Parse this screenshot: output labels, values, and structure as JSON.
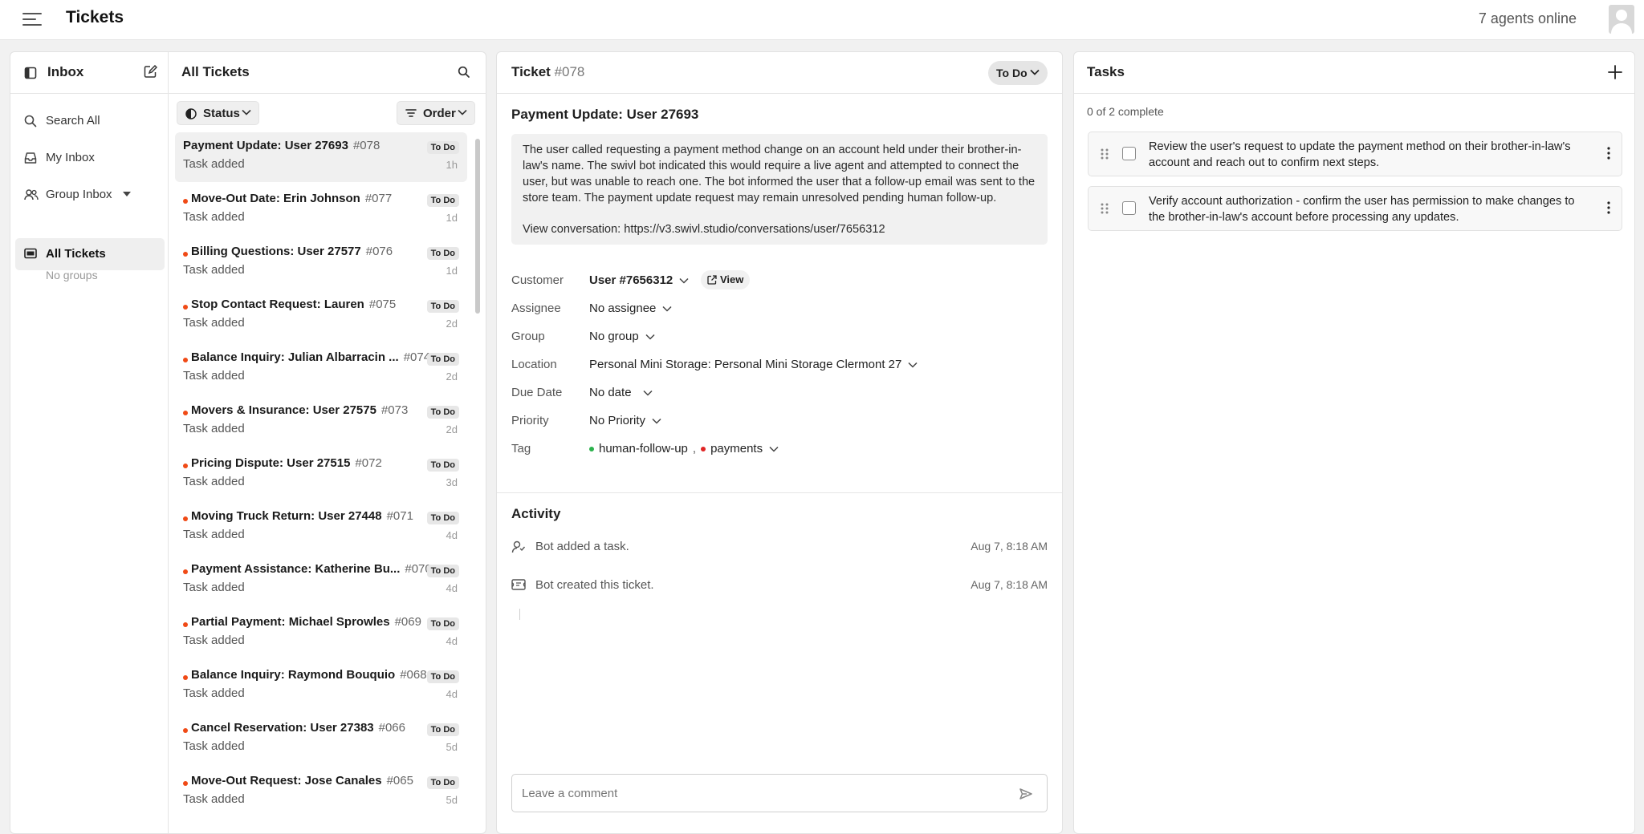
{
  "app": {
    "title": "Tickets",
    "agents_online": "7 agents online"
  },
  "inbox": {
    "title": "Inbox",
    "nav": [
      {
        "label": "Search All",
        "icon": "search-icon"
      },
      {
        "label": "My Inbox",
        "icon": "inbox-tray-icon"
      },
      {
        "label": "Group Inbox",
        "icon": "users-icon"
      },
      {
        "label": "All Tickets",
        "icon": "ticket-icon"
      }
    ],
    "empty_groups": "No groups"
  },
  "list": {
    "title": "All Tickets",
    "status_filter": "Status",
    "order_filter": "Order",
    "tickets": [
      {
        "title": "Payment Update: User 27693",
        "number": "#078",
        "status": "To Do",
        "age": "1h",
        "sub": "Task added"
      },
      {
        "title": "Move-Out Date: Erin Johnson",
        "number": "#077",
        "status": "To Do",
        "age": "1d",
        "sub": "Task added"
      },
      {
        "title": "Billing Questions: User 27577",
        "number": "#076",
        "status": "To Do",
        "age": "1d",
        "sub": "Task added"
      },
      {
        "title": "Stop Contact Request: Lauren",
        "number": "#075",
        "status": "To Do",
        "age": "2d",
        "sub": "Task added"
      },
      {
        "title": "Balance Inquiry: Julian Albarracin ...",
        "number": "#074",
        "status": "To Do",
        "age": "2d",
        "sub": "Task added"
      },
      {
        "title": "Movers & Insurance: User 27575",
        "number": "#073",
        "status": "To Do",
        "age": "2d",
        "sub": "Task added"
      },
      {
        "title": "Pricing Dispute: User 27515",
        "number": "#072",
        "status": "To Do",
        "age": "3d",
        "sub": "Task added"
      },
      {
        "title": "Moving Truck Return: User 27448",
        "number": "#071",
        "status": "To Do",
        "age": "4d",
        "sub": "Task added"
      },
      {
        "title": "Payment Assistance: Katherine Bu...",
        "number": "#070",
        "status": "To Do",
        "age": "4d",
        "sub": "Task added"
      },
      {
        "title": "Partial Payment: Michael Sprowles",
        "number": "#069",
        "status": "To Do",
        "age": "4d",
        "sub": "Task added"
      },
      {
        "title": "Balance Inquiry: Raymond Bouquio",
        "number": "#068",
        "status": "To Do",
        "age": "4d",
        "sub": "Task added"
      },
      {
        "title": "Cancel Reservation: User 27383",
        "number": "#066",
        "status": "To Do",
        "age": "5d",
        "sub": "Task added"
      },
      {
        "title": "Move-Out Request: Jose Canales",
        "number": "#065",
        "status": "To Do",
        "age": "5d",
        "sub": "Task added"
      }
    ]
  },
  "ticket": {
    "label": "Ticket",
    "number": "#078",
    "status": "To Do",
    "subject": "Payment Update: User 27693",
    "description": "The user called requesting a payment method change on an account held under their brother-in-law's name. The swivl bot indicated this would require a live agent and attempted to connect the user, but was unable to reach one. The bot informed the user that a follow-up email was sent to the store team. The payment update request may remain unresolved pending human follow-up.",
    "conversation": "View conversation: https://v3.swivl.studio/conversations/user/7656312",
    "fields": {
      "customer_label": "Customer",
      "customer_value": "User #7656312",
      "view_label": "View",
      "assignee_label": "Assignee",
      "assignee_value": "No assignee",
      "group_label": "Group",
      "group_value": "No group",
      "location_label": "Location",
      "location_value": "Personal Mini Storage: Personal Mini Storage Clermont 27",
      "due_label": "Due Date",
      "due_value": "No date",
      "priority_label": "Priority",
      "priority_value": "No Priority",
      "tag_label": "Tag",
      "tags": [
        {
          "name": "human-follow-up",
          "color": "#2bb24c"
        },
        {
          "name": "payments",
          "color": "#e02424"
        }
      ],
      "tag_separator": ","
    },
    "activity_title": "Activity",
    "activity": [
      {
        "text": "Bot added a task.",
        "time": "Aug 7, 8:18 AM",
        "icon": "task-assign-icon"
      },
      {
        "text": "Bot created this ticket.",
        "time": "Aug 7, 8:18 AM",
        "icon": "ticket-created-icon"
      }
    ],
    "comment_placeholder": "Leave a comment"
  },
  "tasks": {
    "title": "Tasks",
    "progress": "0 of 2 complete",
    "items": [
      {
        "text": "Review the user's request to update the payment method on their brother-in-law's account and reach out to confirm next steps.",
        "done": false
      },
      {
        "text": "Verify account authorization - confirm the user has permission to make changes to the brother-in-law's account before processing any updates.",
        "done": false
      }
    ]
  },
  "colors": {
    "unread_dot": "#f04a16",
    "badge_bg": "#e7e7e7",
    "selected_row": "#f0f0f0"
  }
}
